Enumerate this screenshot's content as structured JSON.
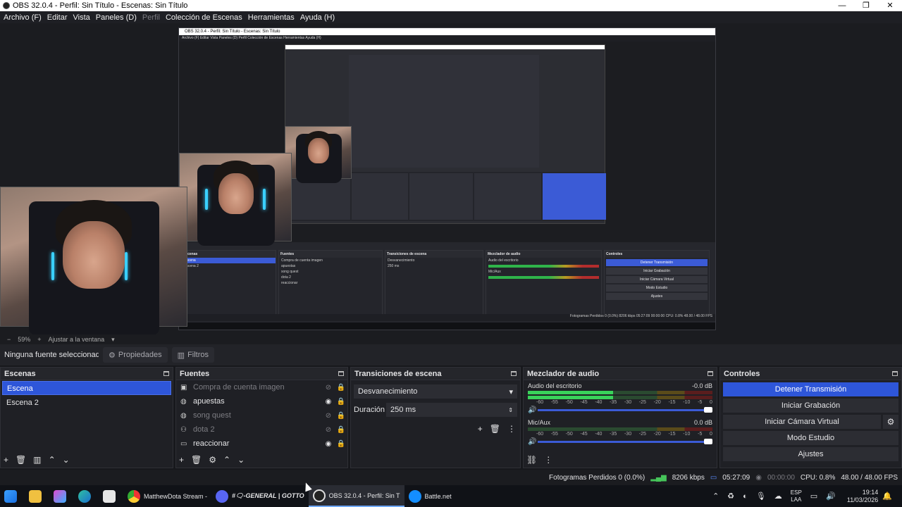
{
  "window": {
    "title": "OBS 32.0.4 - Perfil: Sin Título - Escenas: Sin Título",
    "controls": [
      "—",
      "❐",
      "✕"
    ]
  },
  "menu": {
    "archivo": "Archivo (F)",
    "editar": "Editar",
    "vista": "Vista",
    "paneles": "Paneles (D)",
    "perfil": "Perfil",
    "coleccion": "Colección de Escenas",
    "herramientas": "Herramientas",
    "ayuda": "Ayuda (H)"
  },
  "nested_preview": {
    "title": "OBS 32.0.4 - Perfil: Sin Título - Escenas: Sin Título",
    "menu": "Archivo (F)   Editar   Vista   Paneles (D)   Perfil   Colección de Escenas   Herramientas   Ayuda (H)",
    "scenes_header": "Escenas",
    "sources_header": "Fuentes",
    "transitions_header": "Transiciones de escena",
    "mixer_header": "Mezclador de audio",
    "controls_header": "Controles",
    "status": "Fotogramas Perdidos 0 (0.0%)   8206 kbps   05:27:09   00:00:00   CPU: 0.8%   48.00 / 48.00 FPS"
  },
  "zoom": {
    "minus": "−",
    "value": "59%",
    "plus": "+",
    "fit": "Ajustar a la ventana"
  },
  "source_toolbar": {
    "no_source": "Ninguna fuente seleccionad",
    "properties": "Propiedades",
    "filters": "Filtros"
  },
  "scenes": {
    "header": "Escenas",
    "items": [
      "Escena",
      "Escena 2"
    ]
  },
  "sources": {
    "header": "Fuentes",
    "items": [
      {
        "name": "Compra de cuenta imagen",
        "icon": "image-icon",
        "visible": false
      },
      {
        "name": "apuestas",
        "icon": "browser-icon",
        "visible": true
      },
      {
        "name": "song quest",
        "icon": "browser-icon",
        "visible": false
      },
      {
        "name": "dota 2",
        "icon": "game-capture-icon",
        "visible": false
      },
      {
        "name": "reaccionar",
        "icon": "display-capture-icon",
        "visible": true
      }
    ]
  },
  "transitions": {
    "header": "Transiciones de escena",
    "selected": "Desvanecimiento",
    "duration_label": "Duración",
    "duration_value": "250 ms"
  },
  "mixer": {
    "header": "Mezclador de audio",
    "channels": [
      {
        "name": "Audio del escritorio",
        "db": "-0.0 dB",
        "level": 0.46,
        "fader": 1.0
      },
      {
        "name": "Mic/Aux",
        "db": "0.0 dB",
        "level": 0.0,
        "fader": 1.0
      }
    ],
    "ticks": [
      "-60",
      "-55",
      "-50",
      "-45",
      "-40",
      "-35",
      "-30",
      "-25",
      "-20",
      "-15",
      "-10",
      "-5",
      "0"
    ]
  },
  "controls": {
    "header": "Controles",
    "stop_stream": "Detener Transmisión",
    "start_recording": "Iniciar Grabación",
    "virtual_camera": "Iniciar Cámara Virtual",
    "studio_mode": "Modo Estudio",
    "settings": "Ajustes"
  },
  "status": {
    "dropped_frames": "Fotogramas Perdidos 0 (0.0%)",
    "bitrate": "8206 kbps",
    "stream_time": "05:27:09",
    "record_time": "00:00:00",
    "cpu": "CPU: 0.8%",
    "fps": "48.00 / 48.00 FPS"
  },
  "taskbar": {
    "apps": [
      {
        "label": "",
        "icon": "windows-start-icon"
      },
      {
        "label": "",
        "icon": "file-explorer-icon"
      },
      {
        "label": "",
        "icon": "copilot-icon"
      },
      {
        "label": "",
        "icon": "edge-icon"
      },
      {
        "label": "",
        "icon": "store-icon"
      },
      {
        "label": "MatthewDota Stream - ",
        "icon": "chrome-icon"
      },
      {
        "label": "#🗨-GENERAL | GOTTO",
        "icon": "discord-icon"
      },
      {
        "label": "OBS 32.0.4 - Perfil: Sin T",
        "icon": "obs-icon"
      },
      {
        "label": "Battle.net",
        "icon": "battlenet-icon"
      }
    ],
    "lang_top": "ESP",
    "lang_bottom": "LAA",
    "time": "19:14",
    "date": "11/03/2026"
  },
  "colors": {
    "accent": "#2e56d9",
    "background": "#17181c",
    "panel": "#1f2025",
    "meter_green": "#39d35a"
  }
}
